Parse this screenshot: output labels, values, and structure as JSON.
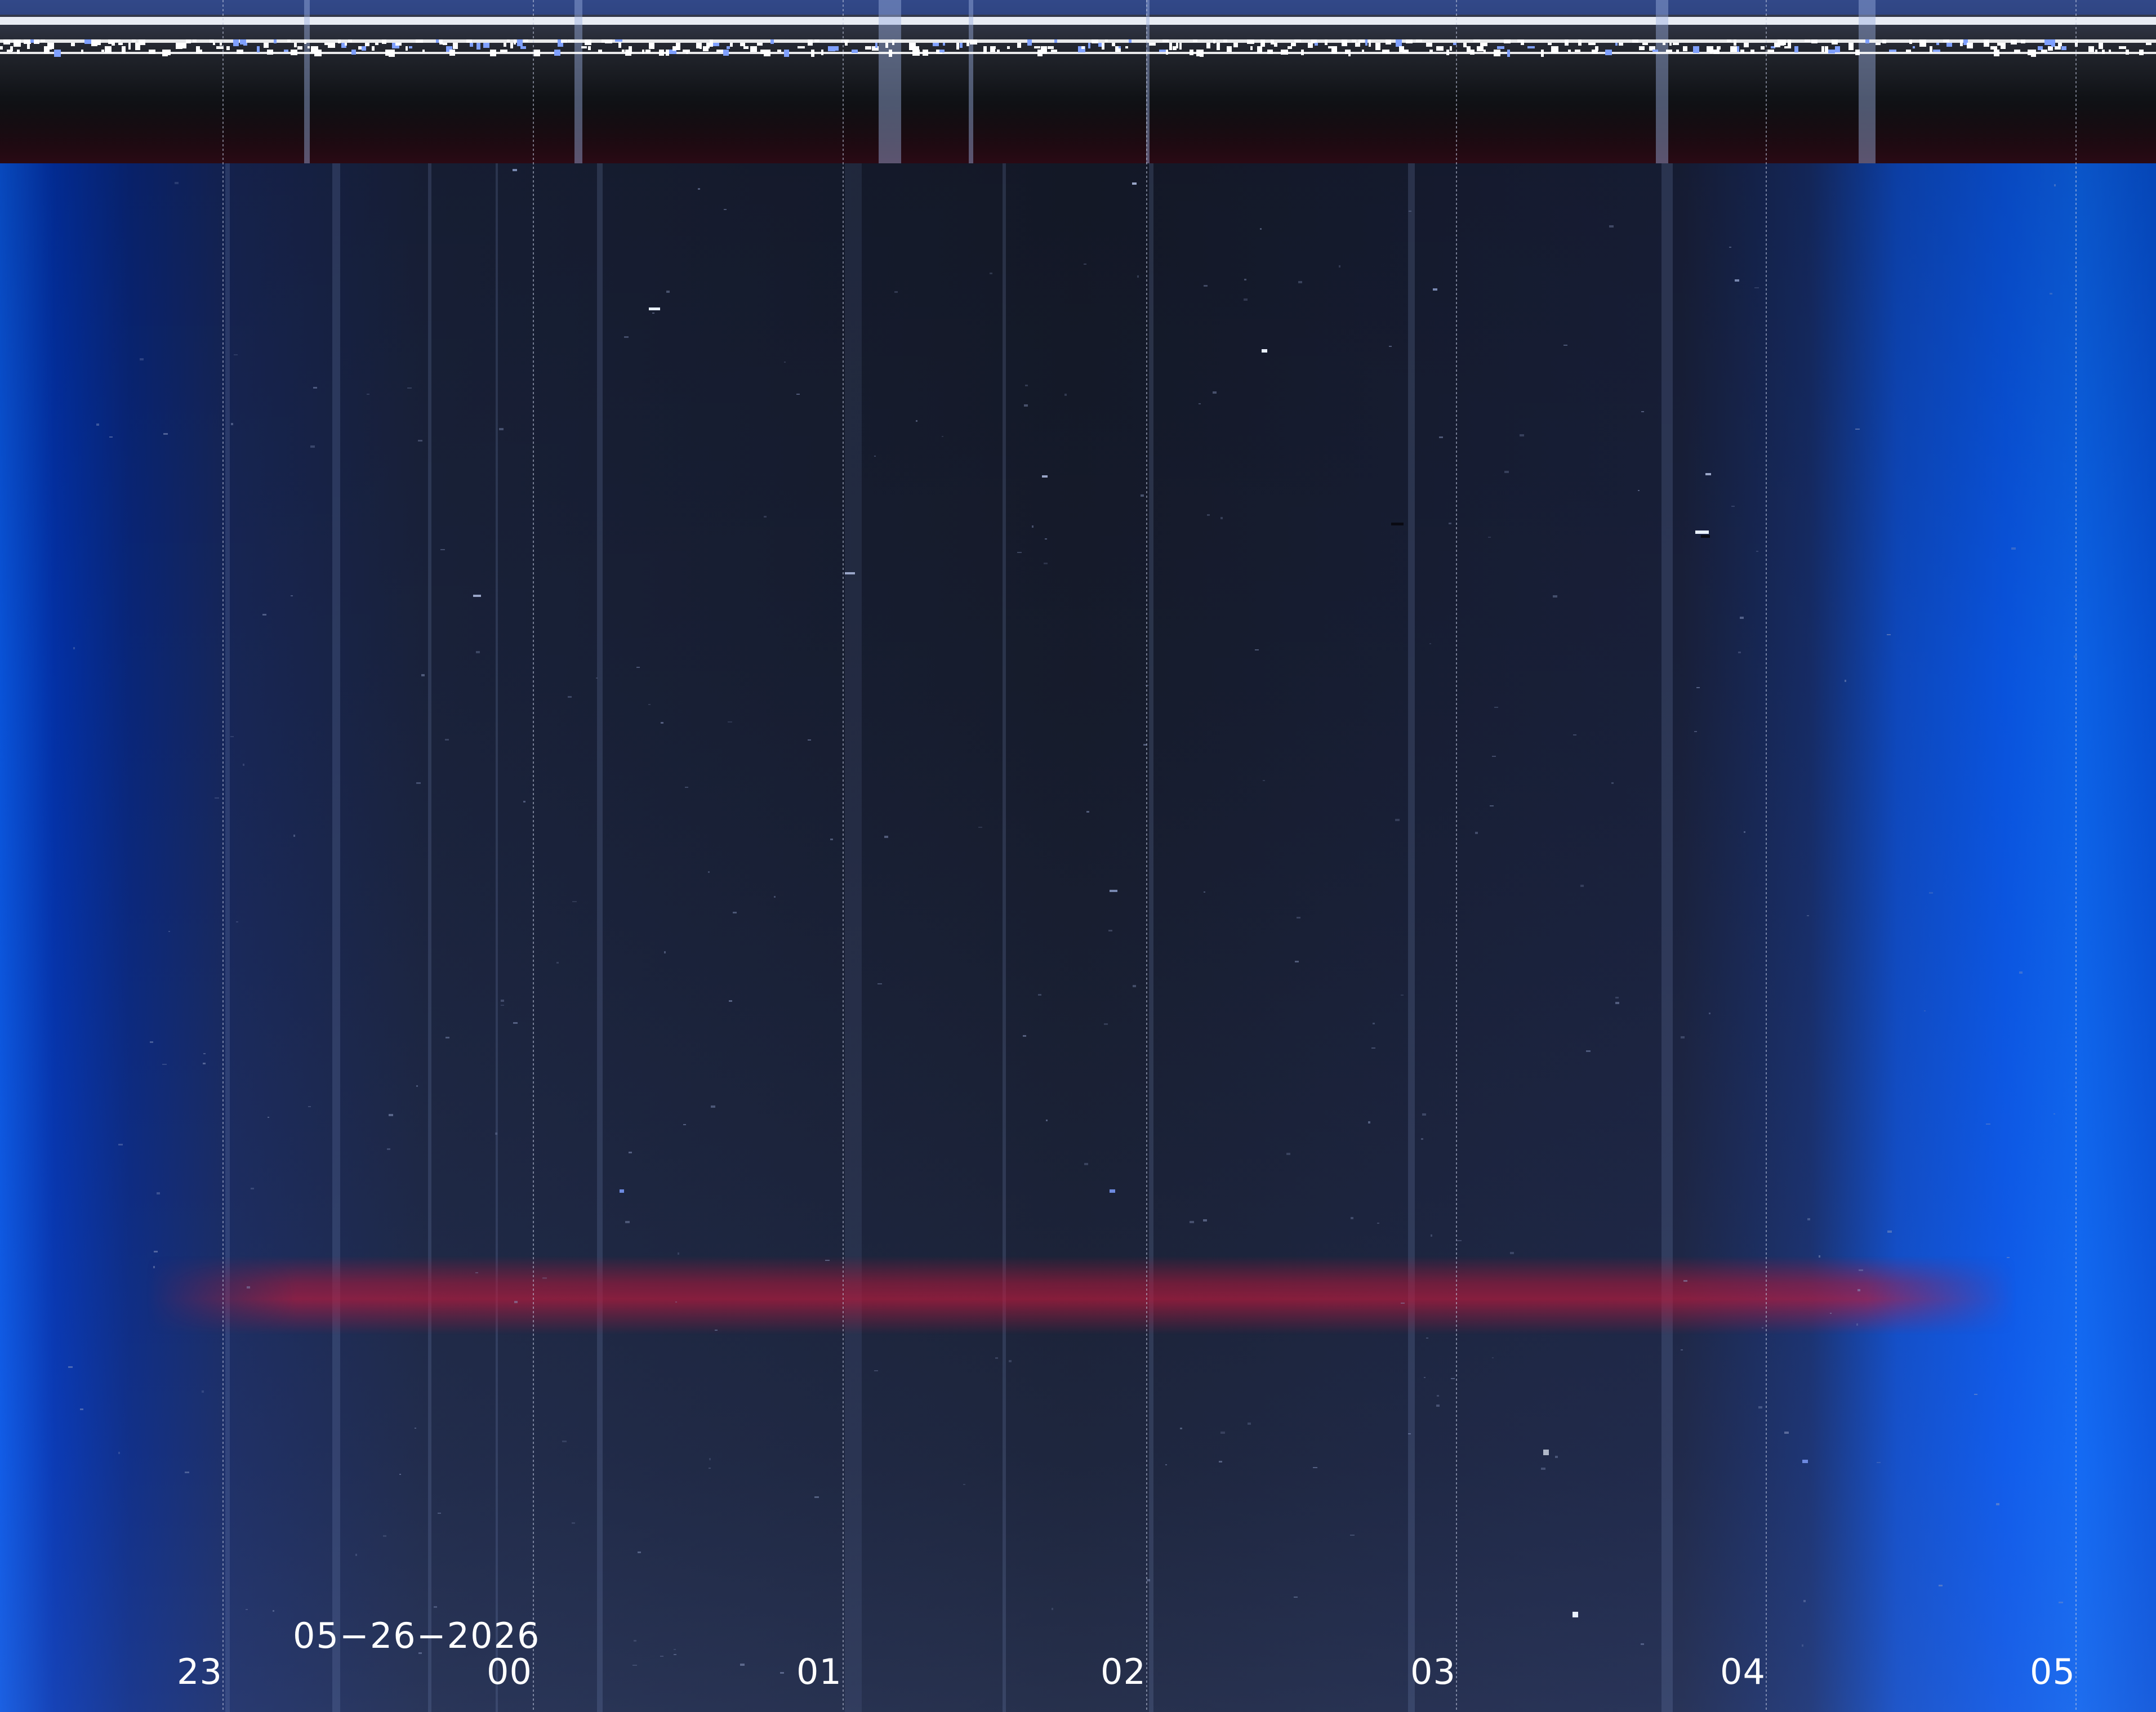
{
  "image": {
    "kind": "keogram",
    "description_colors": {
      "night_sky": "#1b2235",
      "twilight_blue": "#0a5cff",
      "aurora_band": "#b3183a",
      "header_band": "#0d0f16",
      "grid_line": "#b8bfd0"
    }
  },
  "date_label": "05−26−2026",
  "hour_labels": [
    {
      "id": "23",
      "text": "23"
    },
    {
      "id": "00",
      "text": "00"
    },
    {
      "id": "01",
      "text": "01"
    },
    {
      "id": "02",
      "text": "02"
    },
    {
      "id": "03",
      "text": "03"
    },
    {
      "id": "04",
      "text": "04"
    },
    {
      "id": "05",
      "text": "05"
    }
  ]
}
